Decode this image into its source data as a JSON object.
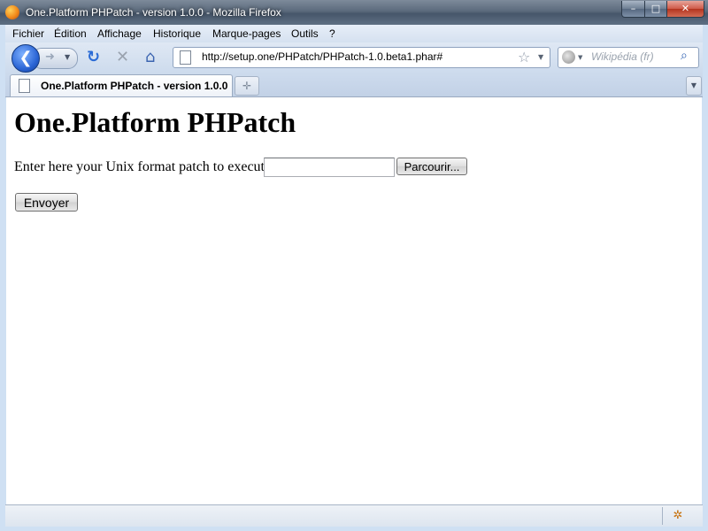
{
  "window": {
    "title": "One.Platform PHPatch - version 1.0.0 - Mozilla Firefox",
    "controls": {
      "minimize": "–",
      "maximize": "□",
      "close": "✕"
    }
  },
  "menubar": {
    "items": [
      "Fichier",
      "Édition",
      "Affichage",
      "Historique",
      "Marque-pages",
      "Outils",
      "?"
    ]
  },
  "navbar": {
    "icons": {
      "back": "back-arrow-icon",
      "forward": "forward-arrow-icon",
      "reload": "reload-icon",
      "stop": "stop-icon",
      "home": "home-icon"
    },
    "url": "http://setup.one/PHPatch/PHPatch-1.0.beta1.phar#",
    "search_placeholder": "Wikipédia (fr)"
  },
  "tabs": [
    {
      "label": "One.Platform PHPatch - version 1.0.0",
      "active": true
    }
  ],
  "content": {
    "heading": "One.Platform PHPatch",
    "form_label": "Enter here your Unix format patch to execute :",
    "file_value": "",
    "browse_label": "Parcourir...",
    "submit_label": "Envoyer"
  },
  "statusbar": {
    "text": ""
  },
  "colors": {
    "chrome": "#cfe0f3",
    "titlebar": "#5b6a7c",
    "page_bg": "#ffffff",
    "link_blue": "#2a6bd6"
  }
}
